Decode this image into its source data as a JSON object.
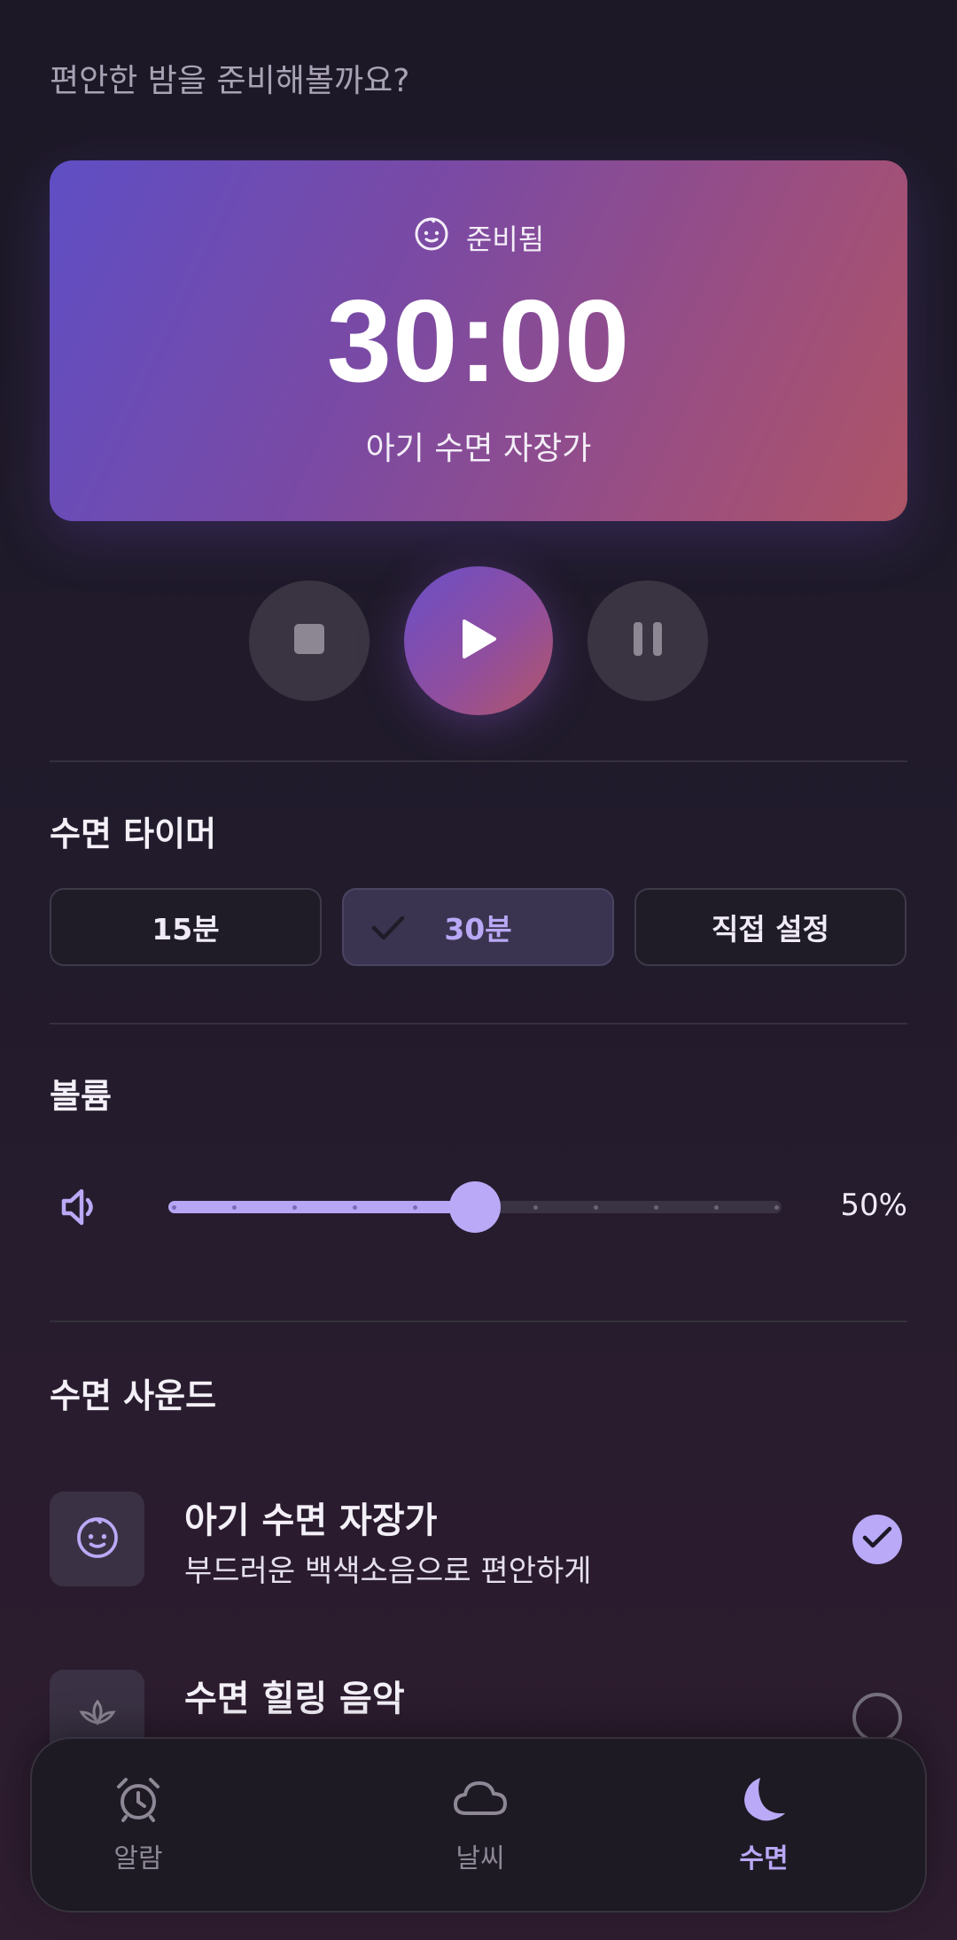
{
  "header": {
    "greeting": "편안한 밤을 준비해볼까요?"
  },
  "player": {
    "status": "준비됨",
    "time": "30:00",
    "track_title": "아기 수면 자장가",
    "status_icon": "baby-face-icon",
    "controls": {
      "stop": "stop-icon",
      "play": "play-icon",
      "pause": "pause-icon"
    }
  },
  "timer": {
    "title": "수면 타이머",
    "options": [
      {
        "label": "15분",
        "selected": false
      },
      {
        "label": "30분",
        "selected": true
      },
      {
        "label": "직접 설정",
        "selected": false
      }
    ]
  },
  "volume": {
    "title": "볼륨",
    "value_label": "50%",
    "level": 0.5,
    "icon": "volume-low-icon"
  },
  "sounds": {
    "title": "수면 사운드",
    "items": [
      {
        "title": "아기 수면 자장가",
        "subtitle": "부드러운 백색소음으로 편안하게",
        "icon": "baby-face-icon",
        "selected": true
      },
      {
        "title": "수면 힐링 음악",
        "subtitle": "",
        "icon": "lotus-icon",
        "selected": false
      }
    ]
  },
  "nav": {
    "items": [
      {
        "label": "알람",
        "icon": "alarm-clock-icon",
        "active": false
      },
      {
        "label": "날씨",
        "icon": "cloud-icon",
        "active": false
      },
      {
        "label": "수면",
        "icon": "moon-icon",
        "active": true
      }
    ]
  },
  "colors": {
    "accent": "#b9a9f6",
    "hero_start": "#5f4ec4",
    "hero_end": "#ad5466"
  }
}
